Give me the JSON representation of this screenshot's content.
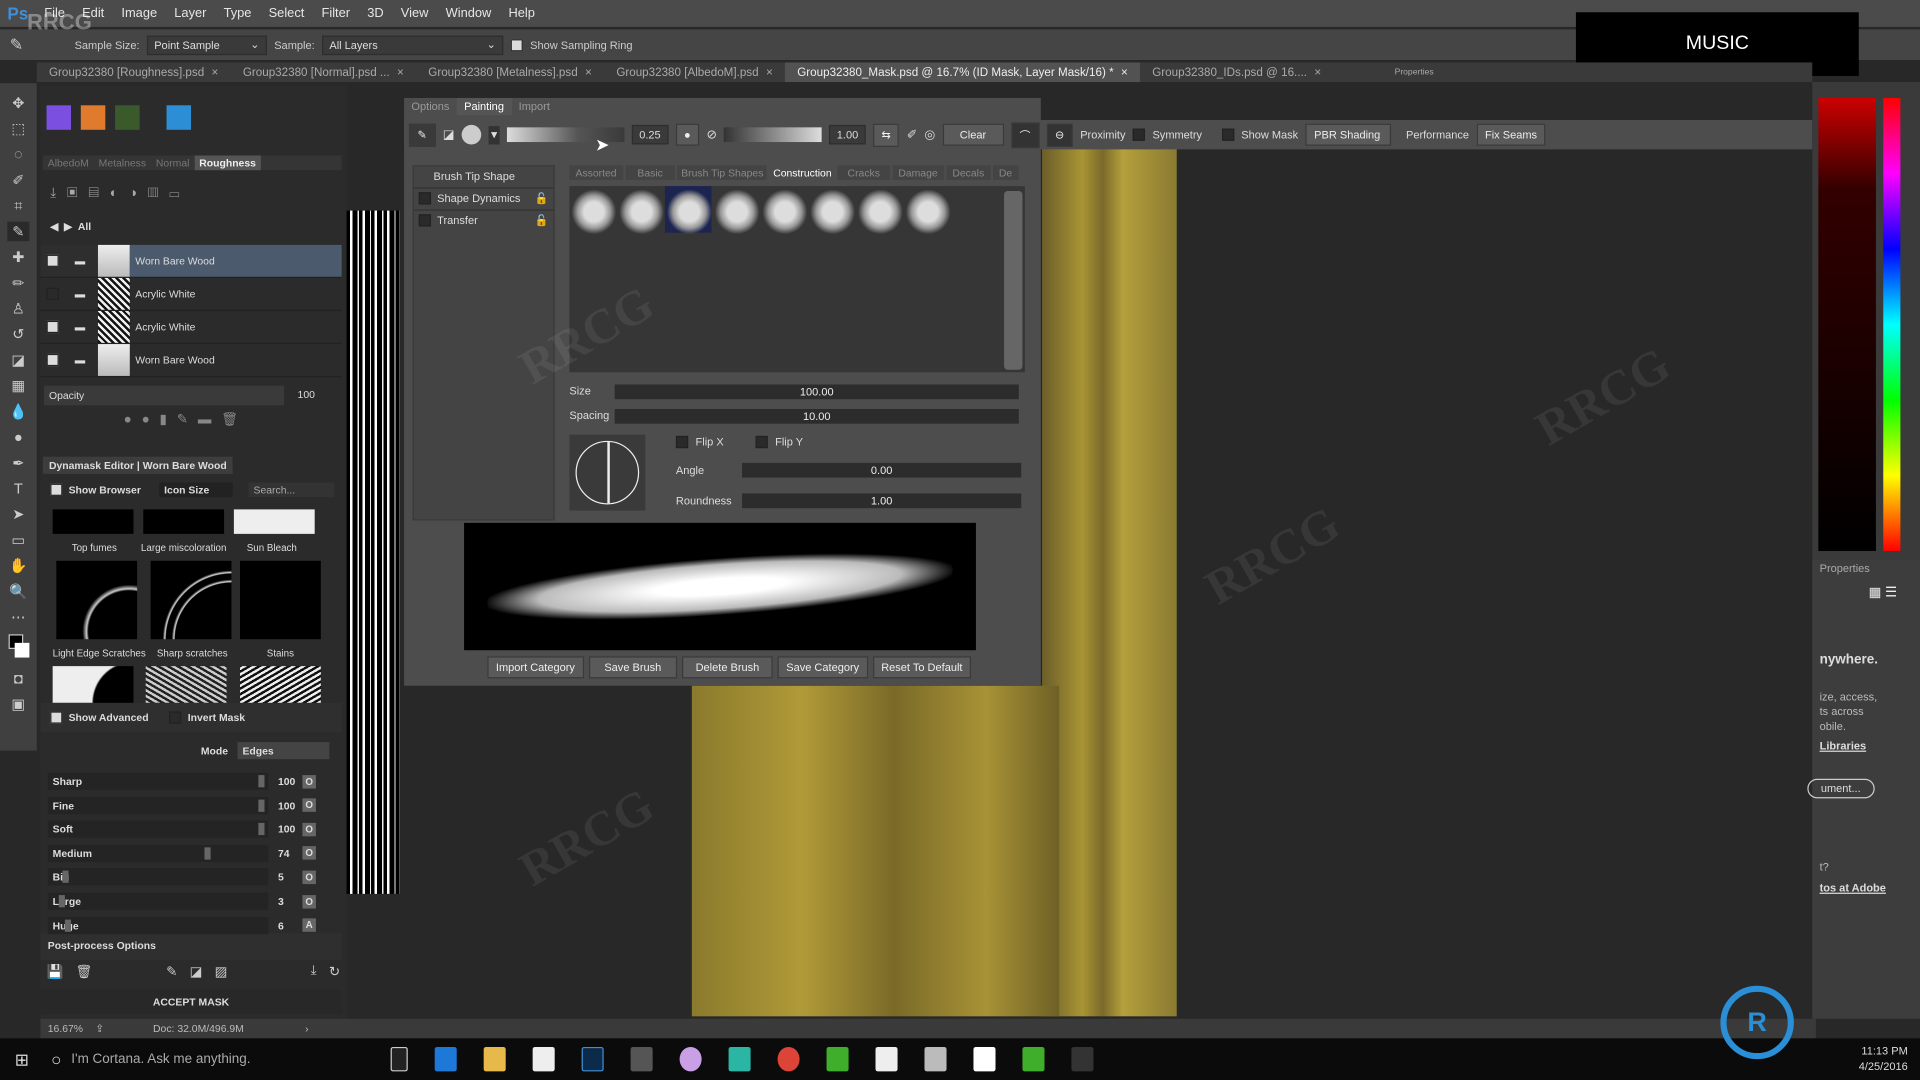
{
  "app": {
    "logo": "Ps",
    "watermark": "RRCG"
  },
  "menu": [
    "File",
    "Edit",
    "Image",
    "Layer",
    "Type",
    "Select",
    "Filter",
    "3D",
    "View",
    "Window",
    "Help"
  ],
  "options": {
    "sample_size_label": "Sample Size:",
    "sample_size": "Point Sample",
    "sample_label": "Sample:",
    "sample": "All Layers",
    "show_sampling_ring": "Show Sampling Ring"
  },
  "doc_tabs": [
    "Group32380 [Roughness].psd",
    "Group32380 [Normal].psd ...",
    "Group32380 [Metalness].psd",
    "Group32380 [AlbedoM].psd",
    "Group32380_Mask.psd @ 16.7% (ID Mask, Layer Mask/16) *",
    "Group32380_IDs.psd @ 16...."
  ],
  "overlay_box": "MUSIC",
  "properties_tab": "Properties",
  "layers_panel": {
    "channel_tabs": [
      "AlbedoM",
      "Metalness",
      "Normal",
      "Roughness"
    ],
    "active_tab": "Roughness",
    "breadcrumb": "All",
    "layers": [
      {
        "name": "Worn Bare Wood",
        "selected": true
      },
      {
        "name": "Acrylic White"
      },
      {
        "name": "Acrylic White"
      },
      {
        "name": "Worn Bare Wood"
      }
    ],
    "opacity_label": "Opacity",
    "opacity": "100"
  },
  "dynamask": {
    "title": "Dynamask Editor  |  Worn Bare Wood",
    "show_browser": "Show Browser",
    "icon_size": "Icon Size",
    "search_placeholder": "Search...",
    "thumbs_row1": [
      "Top fumes",
      "Large miscoloration",
      "Sun Bleach"
    ],
    "thumbs_row2": [
      "Light Edge Scratches",
      "Sharp scratches",
      "Stains"
    ],
    "show_advanced": "Show Advanced",
    "invert_mask": "Invert Mask",
    "mode_label": "Mode",
    "mode": "Edges",
    "sliders": [
      {
        "label": "Sharp",
        "value": "100",
        "fill": 100,
        "btn": "O"
      },
      {
        "label": "Fine",
        "value": "100",
        "fill": 100,
        "btn": "O"
      },
      {
        "label": "Soft",
        "value": "100",
        "fill": 100,
        "btn": "O"
      },
      {
        "label": "Medium",
        "value": "74",
        "fill": 74,
        "btn": "O"
      },
      {
        "label": "Big",
        "value": "5",
        "fill": 5,
        "btn": "O"
      },
      {
        "label": "Large",
        "value": "3",
        "fill": 3,
        "btn": "O"
      },
      {
        "label": "Huge",
        "value": "6",
        "fill": 6,
        "btn": "A"
      }
    ],
    "post_process": "Post-process Options",
    "accept": "ACCEPT MASK"
  },
  "painting": {
    "tabs": [
      "Options",
      "Painting",
      "Import"
    ],
    "active": "Painting",
    "opacity_val": "0.25",
    "flow_val": "1.00",
    "clear": "Clear",
    "proximity": "Proximity",
    "symmetry": "Symmetry",
    "show_mask": "Show Mask",
    "shading": "PBR Shading",
    "performance": "Performance",
    "fix_seams": "Fix Seams",
    "sections": [
      "Brush Tip Shape",
      "Shape Dynamics",
      "Transfer"
    ],
    "categories": [
      "Assorted",
      "Basic",
      "Brush Tip Shapes",
      "Construction",
      "Cracks",
      "Damage",
      "Decals",
      "De"
    ],
    "active_category": "Construction",
    "size_label": "Size",
    "size": "100.00",
    "spacing_label": "Spacing",
    "spacing": "10.00",
    "flip_x": "Flip X",
    "flip_y": "Flip Y",
    "angle_label": "Angle",
    "angle": "0.00",
    "roundness_label": "Roundness",
    "roundness": "1.00",
    "buttons": [
      "Import Category",
      "Save Brush",
      "Delete Brush",
      "Save Category",
      "Reset To Default"
    ]
  },
  "libraries": {
    "tab": "Libraries",
    "text1": "nywhere.",
    "text2": "ize, access,",
    "text3": "ts across",
    "text4": "obile.",
    "link1": "Libraries",
    "button": "ument...",
    "text5": "t?",
    "link2": "tos at Adobe"
  },
  "status": {
    "zoom": "16.67%",
    "doc": "Doc: 32.0M/496.9M"
  },
  "taskbar": {
    "cortana": "I'm Cortana. Ask me anything.",
    "time": "11:13 PM",
    "date": "4/25/2016"
  }
}
